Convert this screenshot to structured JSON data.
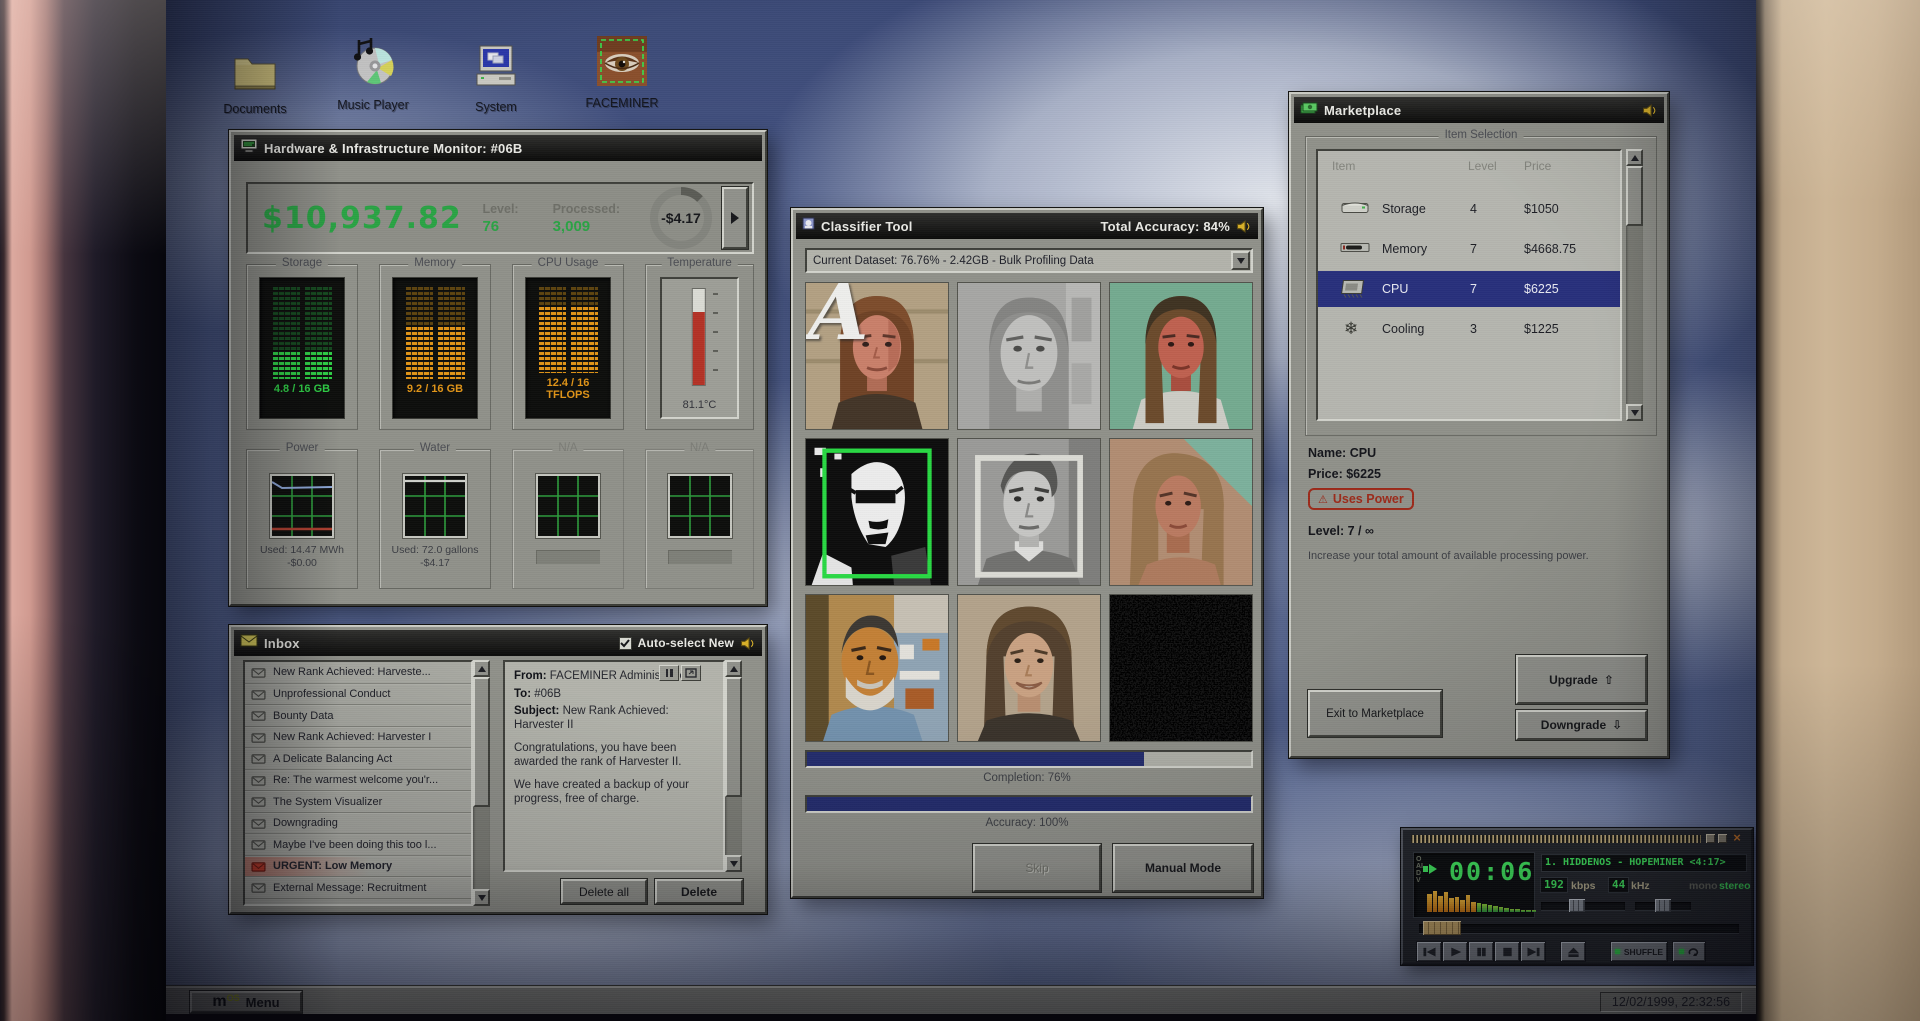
{
  "desktop": {
    "icons": [
      {
        "label": "Documents"
      },
      {
        "label": "Music Player"
      },
      {
        "label": "System"
      },
      {
        "label": "FACEMINER"
      }
    ]
  },
  "taskbar": {
    "logo": "m",
    "logo_sup": "OS",
    "menu_label": "Menu",
    "clock": "12/02/1999, 22:32:56"
  },
  "hardware_monitor": {
    "title": "Hardware & Infrastructure Monitor: #06B",
    "balance": "$10,937.82",
    "level_label": "Level:",
    "level_value": "76",
    "processed_label": "Processed:",
    "processed_value": "3,009",
    "rate_value": "-$4.17",
    "gauges": [
      {
        "label": "Storage",
        "value": "4.8 / 16 GB"
      },
      {
        "label": "Memory",
        "value": "9.2 / 16 GB"
      },
      {
        "label": "CPU Usage",
        "value": "12.4 / 16 TFLOPS"
      },
      {
        "label": "Temperature",
        "value": "81.1°C"
      }
    ],
    "pcts": {
      "storage": 30,
      "memory": 57,
      "cpu": 77,
      "temp": 76
    },
    "meters": [
      {
        "label": "Power",
        "used": "Used: 14.47 MWh",
        "cost": "-$0.00"
      },
      {
        "label": "Water",
        "used": "Used: 72.0 gallons",
        "cost": "-$4.17"
      },
      {
        "label": "N/A",
        "used": "",
        "cost": ""
      },
      {
        "label": "N/A",
        "used": "",
        "cost": ""
      }
    ]
  },
  "inbox": {
    "title": "Inbox",
    "autoselect_label": "Auto-select New",
    "items": [
      {
        "subject": "New Rank Achieved: Harveste..."
      },
      {
        "subject": "Unprofessional Conduct"
      },
      {
        "subject": "Bounty Data"
      },
      {
        "subject": "New Rank Achieved: Harvester I"
      },
      {
        "subject": "A Delicate Balancing Act"
      },
      {
        "subject": "Re: The warmest welcome you'r..."
      },
      {
        "subject": "The System Visualizer"
      },
      {
        "subject": "Downgrading"
      },
      {
        "subject": "Maybe I've been doing this too l..."
      },
      {
        "subject": "URGENT: Low Memory",
        "urgent": true
      },
      {
        "subject": "External Message: Recruitment"
      }
    ],
    "message": {
      "from_label": "From:",
      "from_value": "FACEMINER Administration",
      "to_label": "To:",
      "to_value": "#06B",
      "subject_label": "Subject:",
      "subject_value": "New Rank Achieved: Harvester II",
      "body_1": "Congratulations, you have been awarded the rank of Harvester II.",
      "body_2": "We have created a backup of your progress, free of charge."
    },
    "delete_all_label": "Delete all",
    "delete_label": "Delete"
  },
  "classifier": {
    "title": "Classifier Tool",
    "total_accuracy": "Total Accuracy: 84%",
    "dataset": "Current Dataset: 76.76% - 2.42GB - Bulk Profiling Data",
    "overlay_letter": "A",
    "completion_label": "Completion: 76%",
    "accuracy_label": "Accuracy: 100%",
    "pcts": {
      "completion": 76,
      "accuracy": 100
    },
    "skip_label": "Skip",
    "manual_label": "Manual Mode"
  },
  "marketplace": {
    "title": "Marketplace",
    "section_label": "Item Selection",
    "columns": {
      "item": "Item",
      "level": "Level",
      "price": "Price"
    },
    "items": [
      {
        "name": "Storage",
        "level": "4",
        "price": "$1050"
      },
      {
        "name": "Memory",
        "level": "7",
        "price": "$4668.75"
      },
      {
        "name": "CPU",
        "level": "7",
        "price": "$6225",
        "selected": true
      },
      {
        "name": "Cooling",
        "level": "3",
        "price": "$1225",
        "icon_glyph": "❄"
      }
    ],
    "detail": {
      "name_label": "Name:",
      "name_value": "CPU",
      "price_label": "Price:",
      "price_value": "$6225",
      "badge_icon": "⚠",
      "badge_label": "Uses Power",
      "level_label": "Level:",
      "level_value": "7 / ∞",
      "description": "Increase your total amount of available processing power."
    },
    "exit_label": "Exit to Marketplace",
    "upgrade_label": "Upgrade",
    "upgrade_arrow": "⇧",
    "downgrade_label": "Downgrade",
    "downgrade_arrow": "⇩"
  },
  "player": {
    "time": "00:06",
    "track_title": "1. HIDDENOS - HOPEMINER <4:17>",
    "bitrate_value": "192",
    "bitrate_unit": "kbps",
    "sample_value": "44",
    "sample_unit": "kHz",
    "mono_label": "mono",
    "stereo_label": "stereo",
    "shuffle_label": "SHUFFLE",
    "clutterbar": "OAIDV"
  },
  "colors": {
    "money_green": "#2aa344",
    "alert_orange": "#e09417",
    "urgent_red": "#b23222",
    "selection_navy": "#28307c",
    "lcd_green": "#3fe35c",
    "badge_red": "#9c2a1a"
  }
}
